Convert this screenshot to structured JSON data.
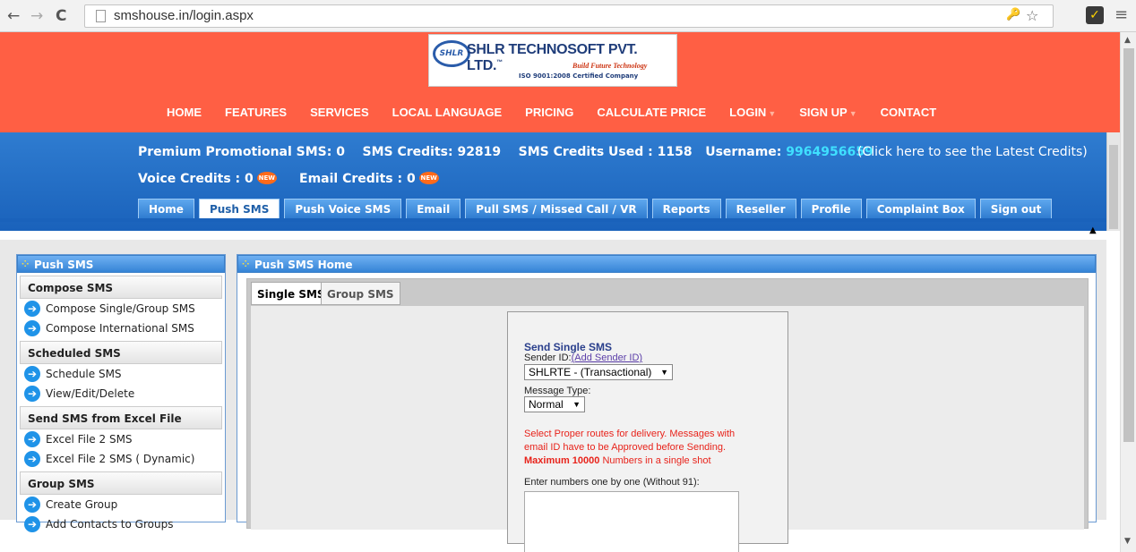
{
  "browser": {
    "back": "←",
    "forward": "→",
    "reload": "C",
    "url": "smshouse.in/login.aspx",
    "menu": "≡",
    "key": "🔑",
    "star": "☆",
    "ext": "✓"
  },
  "logo": {
    "circle": "SHLR",
    "title": "SHLR TECHNOSOFT PVT. LTD.",
    "tm": "™",
    "tagline": "Build Future Technology",
    "iso": "ISO 9001:2008 Certified Company"
  },
  "main_nav": [
    "HOME",
    "FEATURES",
    "SERVICES",
    "LOCAL LANGUAGE",
    "PRICING",
    "CALCULATE PRICE",
    "LOGIN",
    "SIGN UP",
    "CONTACT"
  ],
  "credits": {
    "promo_label": "Premium Promotional SMS: ",
    "promo_value": "0",
    "sms_label": "SMS Credits: ",
    "sms_value": "92819",
    "used_label": "SMS Credits Used : ",
    "used_value": "1158",
    "user_label": "Username: ",
    "user_value": "9964956659",
    "latest": "(Click here to see the Latest Credits)",
    "voice_label": "Voice Credits : ",
    "voice_value": "0",
    "email_label": "Email Credits : ",
    "email_value": "0",
    "new_badge": "NEW"
  },
  "tabs": [
    "Home",
    "Push SMS",
    "Push Voice SMS",
    "Email",
    "Pull SMS / Missed Call / VR",
    "Reports",
    "Reseller",
    "Profile",
    "Complaint Box",
    "Sign out"
  ],
  "left_panel": {
    "title": "Push SMS",
    "sections": [
      {
        "head": "Compose SMS",
        "items": [
          "Compose Single/Group SMS",
          "Compose International SMS"
        ]
      },
      {
        "head": "Scheduled SMS",
        "items": [
          "Schedule SMS",
          "View/Edit/Delete"
        ]
      },
      {
        "head": "Send SMS from Excel File",
        "items": [
          "Excel File 2 SMS",
          "Excel File 2 SMS ( Dynamic)"
        ]
      },
      {
        "head": "Group SMS",
        "items": [
          "Create Group",
          "Add Contacts to Groups"
        ]
      }
    ]
  },
  "right_panel": {
    "title": "Push SMS Home",
    "tab_single": "Single SMS",
    "tab_group": "Group SMS",
    "form": {
      "heading": "Send Single SMS",
      "sender_label": "Sender ID:",
      "sender_link": "(Add Sender ID)",
      "sender_value": "SHLRTE - (Transactional)",
      "msgtype_label": "Message Type:",
      "msgtype_value": "Normal",
      "note1": "Select Proper routes for delivery. Messages with",
      "note2": "email ID have to be Approved before Sending.",
      "note3_bold": "Maximum 10000",
      "note3_rest": " Numbers in a single shot",
      "numbers_label": "Enter numbers one by one (Without 91):"
    }
  },
  "colors": {
    "header_bg": "#ff5f44",
    "blue_bar": "#1a62bb",
    "username": "#3fe0ff",
    "alert_red": "#e8231b"
  }
}
